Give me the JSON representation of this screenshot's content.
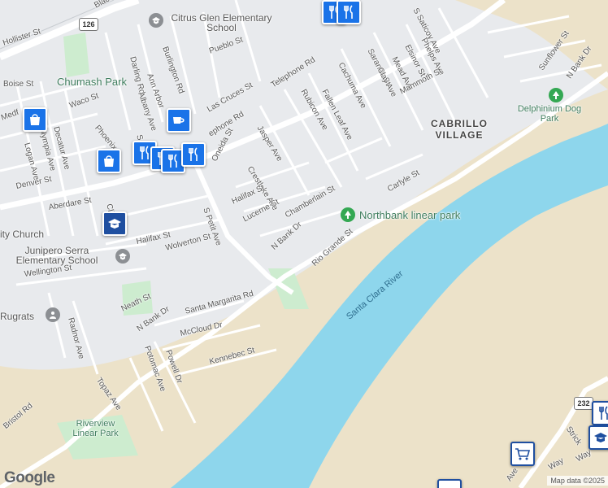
{
  "map": {
    "logo": "Google",
    "attribution": "Map data ©2025",
    "route_shields": [
      "126",
      "232"
    ],
    "colors": {
      "land": "#e8eaed",
      "water": "#8ed6ec",
      "park": "#cdeccf",
      "riverbed": "#ece2c9",
      "road": "#ffffff",
      "poi_blue": "#1a73e8",
      "poi_green": "#3f7d5e"
    }
  },
  "streets": {
    "blackburn": "Blackb",
    "hollister": "Hollister St",
    "boise": "Boise St",
    "darling": "Darling Rd",
    "burlington": "Burlington Rd",
    "pueblo": "Pueblo St",
    "annarbor": "Ann Arbor",
    "albany": "Albany Ave",
    "waco": "Waco St",
    "medford": "Medf",
    "olympia": "Olympia Ave",
    "decatur": "Decatur Ave",
    "logan": "Logan Ave",
    "phoenix": "Phoenix",
    "denver": "Denver St",
    "aberdare": "Aberdare St",
    "clinton": "Cli",
    "halifax1": "Halifax St",
    "wolverton": "Wolverton St",
    "wellington": "Wellington St",
    "radnor": "Radnor Ave",
    "neath": "Neath St",
    "telephone": "Telephone Rd",
    "telephone2": "ephone Rd",
    "lascruces": "Las Cruces St",
    "rubicon": "Rubicon Ave",
    "cachuma": "Cachuma Ave",
    "fallenleaf": "Fallen Leaf Ave",
    "saranac": "Saranac St",
    "clay": "Clay Ave",
    "elsinor": "Elsinor St",
    "mead": "Mead Ave",
    "phelps": "Phelps Ave",
    "saticoy": "S Saticoy Ave",
    "mammoth": "Mammoth St",
    "sunflower": "Sunflower St",
    "nbank_ne": "N Bank Dr",
    "jasper": "Jasper Ave",
    "crestlake": "Crestlake Ave",
    "oneida": "Oneida St",
    "halifax2": "Halifax St",
    "lucerne": "Lucerne St",
    "spetit": "S Petit Ave",
    "spetit2": "S P",
    "chamberlain": "Chamberlain St",
    "carlyle": "Carlyle St",
    "nbank_c": "N Bank Dr",
    "riogrande": "Rio Grande St",
    "nbank_sw": "N Bank Dr",
    "santamargarita": "Santa Margarita Rd",
    "mccloud": "McCloud Dr",
    "potomac": "Potomac Ave",
    "powell": "Powell Dr",
    "kennebec": "Kennebec St",
    "topaz": "Topaz Ave",
    "bristol": "Bristol Rd",
    "strick": "Strick",
    "way1": "Way",
    "way2": "Way",
    "ave_se": "Ave"
  },
  "places": {
    "citrus_glen": "Citrus Glen Elementary School",
    "chumash": "Chumash Park",
    "cabrillo": "CABRILLO VILLAGE",
    "delphinium": "Delphinium Dog Park",
    "northbank": "Northbank linear park",
    "church": "ity Church",
    "junipero": "Junipero Serra Elementary School",
    "rugrats": "Rugrats",
    "riverview": "Riverview Linear Park",
    "river": "Santa Clara River"
  }
}
